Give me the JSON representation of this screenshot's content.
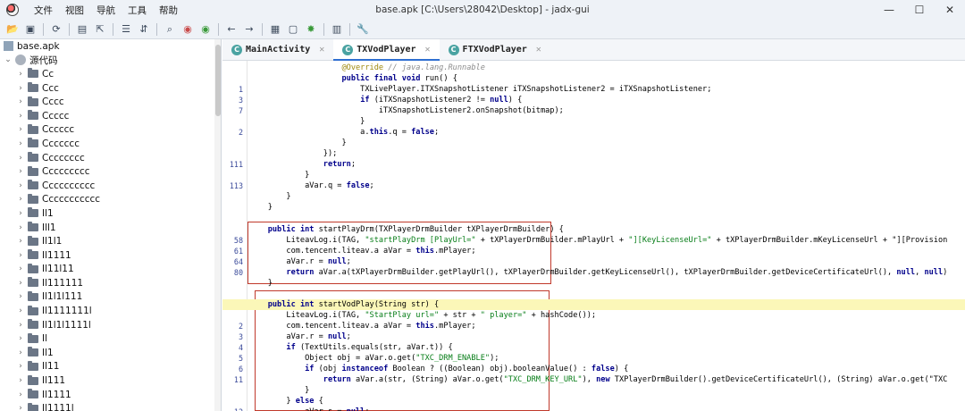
{
  "window": {
    "title": "base.apk [C:\\Users\\28042\\Desktop] - jadx-gui",
    "minimize": "—",
    "maximize": "☐",
    "close": "✕"
  },
  "menu": [
    "文件",
    "视图",
    "导航",
    "工具",
    "帮助"
  ],
  "toolbar": {
    "icons": [
      "open-icon",
      "add-file-icon",
      "reload-icon",
      "save-icon",
      "export-icon",
      "flatten-icon",
      "sync-icon",
      "search-icon",
      "find-class-icon",
      "find-usage-icon",
      "back-icon",
      "forward-icon",
      "deobfuscation-icon",
      "bookmark-icon",
      "plugin-icon",
      "log-icon",
      "settings-icon"
    ]
  },
  "tree": {
    "root": "base.apk",
    "source": "源代码",
    "packages": [
      "Cc",
      "Ccc",
      "Cccc",
      "Ccccc",
      "Cccccc",
      "Ccccccc",
      "Cccccccc",
      "Ccccccccc",
      "Cccccccccc",
      "Ccccccccccc",
      "Il1",
      "Ill1",
      "Il1l1",
      "Il1111",
      "Il11l11",
      "Il111111",
      "Il1l1l111",
      "Il1111111l",
      "Il1l1l1111l",
      "Il",
      "Il1",
      "Il11",
      "Il111",
      "Il1111",
      "Il1111l"
    ]
  },
  "tabs": [
    {
      "label": "MainActivity",
      "icon": "C"
    },
    {
      "label": "TXVodPlayer",
      "icon": "C"
    },
    {
      "label": "FTXVodPlayer",
      "icon": "C"
    }
  ],
  "code": {
    "lines": [
      {
        "n": "",
        "t": "                    @Override // java.lang.Runnable"
      },
      {
        "n": "",
        "t": "                    public final void run() {"
      },
      {
        "n": "1",
        "t": "                        TXLivePlayer.ITXSnapshotListener iTXSnapshotListener2 = iTXSnapshotListener;"
      },
      {
        "n": "3",
        "t": "                        if (iTXSnapshotListener2 != null) {"
      },
      {
        "n": "7",
        "t": "                            iTXSnapshotListener2.onSnapshot(bitmap);"
      },
      {
        "n": "",
        "t": "                        }"
      },
      {
        "n": "2",
        "t": "                        a.this.q = false;"
      },
      {
        "n": "",
        "t": "                    }"
      },
      {
        "n": "",
        "t": "                });"
      },
      {
        "n": "111",
        "t": "                return;"
      },
      {
        "n": "",
        "t": "            }"
      },
      {
        "n": "113",
        "t": "            aVar.q = false;"
      },
      {
        "n": "",
        "t": "        }"
      },
      {
        "n": "",
        "t": "    }"
      },
      {
        "n": "",
        "t": ""
      },
      {
        "n": "",
        "t": "    public int startPlayDrm(TXPlayerDrmBuilder tXPlayerDrmBuilder) {"
      },
      {
        "n": "58",
        "t": "        LiteavLog.i(TAG, \"startPlayDrm [PlayUrl=\" + tXPlayerDrmBuilder.mPlayUrl + \"][KeyLicenseUrl=\" + tXPlayerDrmBuilder.mKeyLicenseUrl + \"][Provision"
      },
      {
        "n": "61",
        "t": "        com.tencent.liteav.a aVar = this.mPlayer;"
      },
      {
        "n": "64",
        "t": "        aVar.r = null;"
      },
      {
        "n": "80",
        "t": "        return aVar.a(tXPlayerDrmBuilder.getPlayUrl(), tXPlayerDrmBuilder.getKeyLicenseUrl(), tXPlayerDrmBuilder.getDeviceCertificateUrl(), null, null)"
      },
      {
        "n": "",
        "t": "    }"
      },
      {
        "n": "",
        "t": ""
      },
      {
        "n": "",
        "t": "    public int startVodPlay(String str) {"
      },
      {
        "n": "",
        "t": "        LiteavLog.i(TAG, \"StartPlay url=\" + str + \" player=\" + hashCode());"
      },
      {
        "n": "2",
        "t": "        com.tencent.liteav.a aVar = this.mPlayer;"
      },
      {
        "n": "3",
        "t": "        aVar.r = null;"
      },
      {
        "n": "4",
        "t": "        if (TextUtils.equals(str, aVar.t)) {"
      },
      {
        "n": "5",
        "t": "            Object obj = aVar.o.get(\"TXC_DRM_ENABLE\");"
      },
      {
        "n": "6",
        "t": "            if (obj instanceof Boolean ? ((Boolean) obj).booleanValue() : false) {"
      },
      {
        "n": "11",
        "t": "                return aVar.a(str, (String) aVar.o.get(\"TXC_DRM_KEY_URL\"), new TXPlayerDrmBuilder().getDeviceCertificateUrl(), (String) aVar.o.get(\"TXC"
      },
      {
        "n": "",
        "t": "            }"
      },
      {
        "n": "",
        "t": "        } else {"
      },
      {
        "n": "12",
        "t": "            aVar.s = null;"
      }
    ]
  },
  "colors": {
    "keyword": "#00008b",
    "string": "#067d17",
    "annotation": "#9e880d",
    "highlight": "#fbf7b8",
    "box": "#c0392b",
    "tab_accent": "#2f6fd1"
  }
}
